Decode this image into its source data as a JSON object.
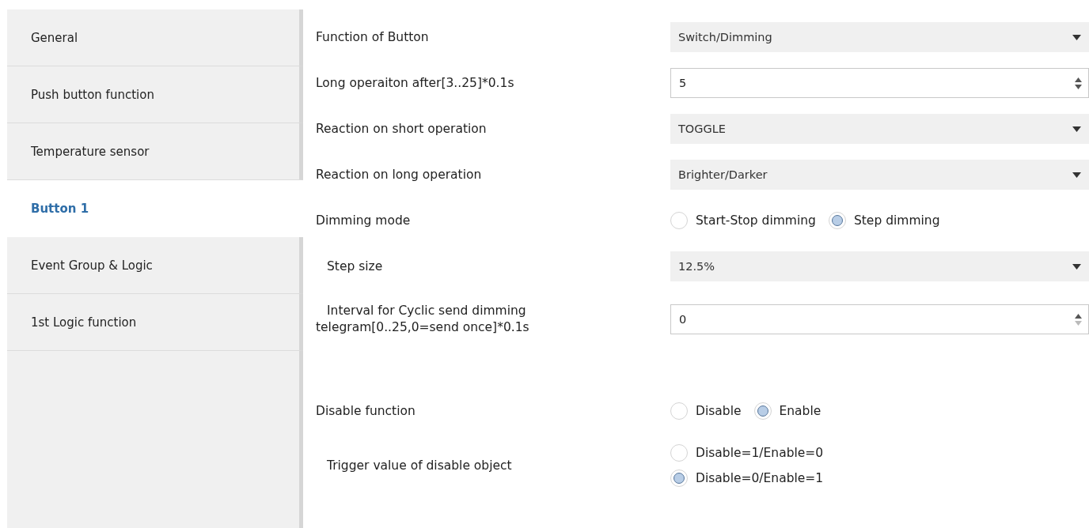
{
  "sidebar": {
    "items": [
      {
        "label": "General",
        "selected": false
      },
      {
        "label": "Push button function",
        "selected": false
      },
      {
        "label": "Temperature sensor",
        "selected": false
      },
      {
        "label": "Button 1",
        "selected": true
      },
      {
        "label": "Event Group & Logic",
        "selected": false
      },
      {
        "label": "1st Logic function",
        "selected": false
      }
    ]
  },
  "sections": [
    {
      "rows": [
        {
          "kind": "dropdown",
          "label": "Function of Button",
          "indented": false,
          "value": "Switch/Dimming"
        },
        {
          "kind": "spin",
          "label": "Long operaiton after[3..25]*0.1s",
          "indented": false,
          "value": "5",
          "down_enabled": true
        },
        {
          "kind": "dropdown",
          "label": "Reaction on short operation",
          "indented": false,
          "value": "TOGGLE"
        },
        {
          "kind": "dropdown",
          "label": "Reaction on long operation",
          "indented": false,
          "value": "Brighter/Darker"
        },
        {
          "kind": "radio",
          "label": "Dimming mode",
          "indented": false,
          "options": [
            {
              "label": "Start-Stop dimming",
              "selected": false
            },
            {
              "label": "Step dimming",
              "selected": true
            }
          ]
        },
        {
          "kind": "dropdown",
          "label": "Step size",
          "indented": true,
          "value": "12.5%"
        },
        {
          "kind": "spin",
          "label": "Interval for Cyclic send dimming telegram[0..25,0=send once]*0.1s",
          "indented": true,
          "value": "0",
          "down_enabled": false
        }
      ]
    },
    {
      "rows": [
        {
          "kind": "radio",
          "label": "Disable function",
          "indented": false,
          "options": [
            {
              "label": "Disable",
              "selected": false
            },
            {
              "label": "Enable",
              "selected": true
            }
          ]
        },
        {
          "kind": "radio_stack",
          "label": "Trigger value of disable object",
          "indented": true,
          "options": [
            {
              "label": "Disable=1/Enable=0",
              "selected": false
            },
            {
              "label": "Disable=0/Enable=1",
              "selected": true
            }
          ]
        }
      ]
    }
  ]
}
